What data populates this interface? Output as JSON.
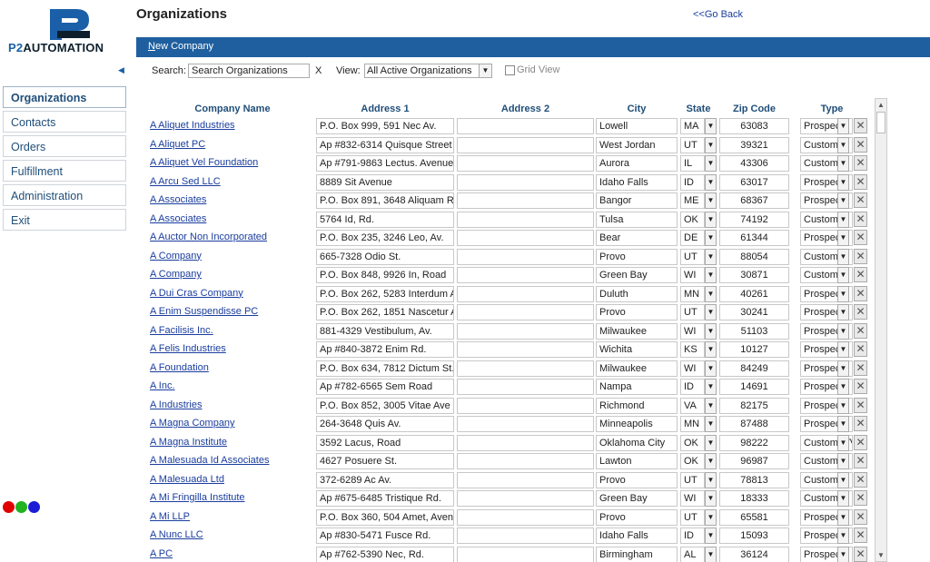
{
  "app": {
    "logo_text_p2": "P2",
    "logo_text_rest": "AUTOMATION",
    "brand_color": "#1a5fa8"
  },
  "header": {
    "title": "Organizations",
    "back_link": "<<Go Back"
  },
  "toolbar": {
    "new_company_first": "N",
    "new_company_rest": "ew Company"
  },
  "search": {
    "label": "Search:",
    "value": "Search Organizations",
    "clear": "X"
  },
  "view": {
    "label": "View:",
    "selected": "All Active Organizations",
    "grid_view_label": "Grid View",
    "grid_view_checked": false
  },
  "sidebar": {
    "items": [
      {
        "label": "Organizations",
        "active": true
      },
      {
        "label": "Contacts",
        "active": false
      },
      {
        "label": "Orders",
        "active": false
      },
      {
        "label": "Fulfillment",
        "active": false
      },
      {
        "label": "Administration",
        "active": false
      },
      {
        "label": "Exit",
        "active": false
      }
    ]
  },
  "status_dots": [
    "#e00000",
    "#1fb31f",
    "#1c1cd6"
  ],
  "table": {
    "columns": [
      "Company Name",
      "Address 1",
      "Address 2",
      "City",
      "State",
      "Zip Code",
      "Type"
    ],
    "rows": [
      {
        "name": "A Aliquet Industries",
        "addr1": "P.O. Box 999, 591 Nec Av.",
        "addr2": "",
        "city": "Lowell",
        "state": "MA",
        "zip": "63083",
        "type": "Prospect"
      },
      {
        "name": "A Aliquet PC",
        "addr1": "Ap #832-6314 Quisque Street",
        "addr2": "",
        "city": "West Jordan",
        "state": "UT",
        "zip": "39321",
        "type": "Customer"
      },
      {
        "name": "A Aliquet Vel Foundation",
        "addr1": "Ap #791-9863 Lectus. Avenue",
        "addr2": "",
        "city": "Aurora",
        "state": "IL",
        "zip": "43306",
        "type": "Customer"
      },
      {
        "name": "A Arcu Sed LLC",
        "addr1": "8889 Sit Avenue",
        "addr2": "",
        "city": "Idaho Falls",
        "state": "ID",
        "zip": "63017",
        "type": "Prospect"
      },
      {
        "name": "A Associates",
        "addr1": "P.O. Box 891, 3648 Aliquam R",
        "addr2": "",
        "city": "Bangor",
        "state": "ME",
        "zip": "68367",
        "type": "Prospect"
      },
      {
        "name": "A Associates",
        "addr1": "5764 Id, Rd.",
        "addr2": "",
        "city": "Tulsa",
        "state": "OK",
        "zip": "74192",
        "type": "Customer"
      },
      {
        "name": "A Auctor Non Incorporated",
        "addr1": "P.O. Box 235, 3246 Leo, Av.",
        "addr2": "",
        "city": "Bear",
        "state": "DE",
        "zip": "61344",
        "type": "Prospect"
      },
      {
        "name": "A Company",
        "addr1": "665-7328 Odio St.",
        "addr2": "",
        "city": "Provo",
        "state": "UT",
        "zip": "88054",
        "type": "Customer"
      },
      {
        "name": "A Company",
        "addr1": "P.O. Box 848, 9926 In, Road",
        "addr2": "",
        "city": "Green Bay",
        "state": "WI",
        "zip": "30871",
        "type": "Customer"
      },
      {
        "name": "A Dui Cras Company",
        "addr1": "P.O. Box 262, 5283 Interdum A",
        "addr2": "",
        "city": "Duluth",
        "state": "MN",
        "zip": "40261",
        "type": "Prospect"
      },
      {
        "name": "A Enim Suspendisse PC",
        "addr1": "P.O. Box 262, 1851 Nascetur A",
        "addr2": "",
        "city": "Provo",
        "state": "UT",
        "zip": "30241",
        "type": "Prospect"
      },
      {
        "name": "A Facilisis Inc.",
        "addr1": "881-4329 Vestibulum, Av.",
        "addr2": "",
        "city": "Milwaukee",
        "state": "WI",
        "zip": "51103",
        "type": "Prospect"
      },
      {
        "name": "A Felis Industries",
        "addr1": "Ap #840-3872 Enim Rd.",
        "addr2": "",
        "city": "Wichita",
        "state": "KS",
        "zip": "10127",
        "type": "Prospect"
      },
      {
        "name": "A Foundation",
        "addr1": "P.O. Box 634, 7812 Dictum St.",
        "addr2": "",
        "city": "Milwaukee",
        "state": "WI",
        "zip": "84249",
        "type": "Prospect"
      },
      {
        "name": "A Inc.",
        "addr1": "Ap #782-6565 Sem Road",
        "addr2": "",
        "city": "Nampa",
        "state": "ID",
        "zip": "14691",
        "type": "Prospect"
      },
      {
        "name": "A Industries",
        "addr1": "P.O. Box 852, 3005 Vitae Ave",
        "addr2": "",
        "city": "Richmond",
        "state": "VA",
        "zip": "82175",
        "type": "Prospect"
      },
      {
        "name": "A Magna Company",
        "addr1": "264-3648 Quis Av.",
        "addr2": "",
        "city": "Minneapolis",
        "state": "MN",
        "zip": "87488",
        "type": "Prospect"
      },
      {
        "name": "A Magna Institute",
        "addr1": "3592 Lacus, Road",
        "addr2": "",
        "city": "Oklahoma City",
        "state": "OK",
        "zip": "98222",
        "type": "Customer/Ve"
      },
      {
        "name": "A Malesuada Id Associates",
        "addr1": "4627 Posuere St.",
        "addr2": "",
        "city": "Lawton",
        "state": "OK",
        "zip": "96987",
        "type": "Customer"
      },
      {
        "name": "A Malesuada Ltd",
        "addr1": "372-6289 Ac Av.",
        "addr2": "",
        "city": "Provo",
        "state": "UT",
        "zip": "78813",
        "type": "Customer"
      },
      {
        "name": "A Mi Fringilla Institute",
        "addr1": "Ap #675-6485 Tristique Rd.",
        "addr2": "",
        "city": "Green Bay",
        "state": "WI",
        "zip": "18333",
        "type": "Customer"
      },
      {
        "name": "A Mi LLP",
        "addr1": "P.O. Box 360, 504 Amet, Aven",
        "addr2": "",
        "city": "Provo",
        "state": "UT",
        "zip": "65581",
        "type": "Prospect"
      },
      {
        "name": "A Nunc LLC",
        "addr1": "Ap #830-5471 Fusce Rd.",
        "addr2": "",
        "city": "Idaho Falls",
        "state": "ID",
        "zip": "15093",
        "type": "Prospect"
      },
      {
        "name": "A PC",
        "addr1": "Ap #762-5390 Nec, Rd.",
        "addr2": "",
        "city": "Birmingham",
        "state": "AL",
        "zip": "36124",
        "type": "Prospect"
      }
    ]
  }
}
